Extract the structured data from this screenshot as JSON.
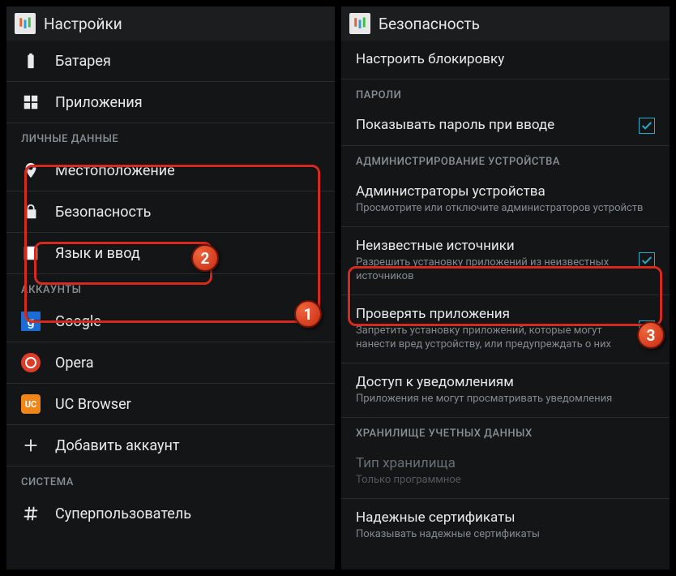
{
  "left": {
    "title": "Настройки",
    "items": {
      "battery": "Батарея",
      "apps": "Приложения"
    },
    "personal_header": "ЛИЧНЫЕ ДАННЫЕ",
    "personal": {
      "location": "Местоположение",
      "security": "Безопасность",
      "language": "Язык и ввод"
    },
    "accounts_header": "АККАУНТЫ",
    "accounts": {
      "google": "Google",
      "opera": "Opera",
      "uc": "UC Browser",
      "add": "Добавить аккаунт"
    },
    "system_header": "СИСТЕМА",
    "system": {
      "superuser": "Суперпользователь"
    }
  },
  "right": {
    "title": "Безопасность",
    "lock": {
      "title": "Настроить блокировку"
    },
    "passwords_header": "ПАРОЛИ",
    "show_password": {
      "title": "Показывать пароль при вводе",
      "checked": true
    },
    "admin_header": "АДМИНИСТРИРОВАНИЕ УСТРОЙСТВА",
    "device_admins": {
      "title": "Администраторы устройства",
      "sub": "Просмотрите или отключите администраторов устройств"
    },
    "unknown_sources": {
      "title": "Неизвестные источники",
      "sub": "Разрешить установку приложений из неизвестных источников",
      "checked": true
    },
    "verify_apps": {
      "title": "Проверять приложения",
      "sub": "Запретить установку приложений, которые могут нанести вред устройству, или предупреждать о них",
      "checked": true
    },
    "notif_access": {
      "title": "Доступ к уведомлениям",
      "sub": "Приложения не могут просматривать уведомления"
    },
    "cred_header": "ХРАНИЛИЩЕ УЧЕТНЫХ ДАННЫХ",
    "storage_type": {
      "title": "Тип хранилища",
      "sub": "Только программное"
    },
    "trusted_certs": {
      "title": "Надежные сертификаты",
      "sub": "Показывать надежные сертификаты"
    }
  },
  "badges": {
    "b1": "1",
    "b2": "2",
    "b3": "3"
  }
}
